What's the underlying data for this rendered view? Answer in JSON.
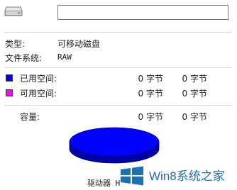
{
  "header": {
    "drive_name_value": "",
    "drive_icon": "removable-drive-icon"
  },
  "info": {
    "type_label": "类型:",
    "type_value": "可移动磁盘",
    "fs_label": "文件系统:",
    "fs_value": "RAW"
  },
  "space": {
    "used": {
      "label": "已用空间:",
      "bytes": "0 字节",
      "size": "0 字节",
      "color": "#0000ff"
    },
    "free": {
      "label": "可用空间:",
      "bytes": "0 字节",
      "size": "0 字节",
      "color": "#ff00ff"
    },
    "capacity": {
      "label": "容量:",
      "bytes": "0 字节",
      "size": "0 字节"
    }
  },
  "chart": {
    "drive_label": "驱动器 H",
    "used_color": "#0000ff"
  },
  "watermark": {
    "text": "Win8系统之家",
    "icon": "windows-logo-icon"
  }
}
